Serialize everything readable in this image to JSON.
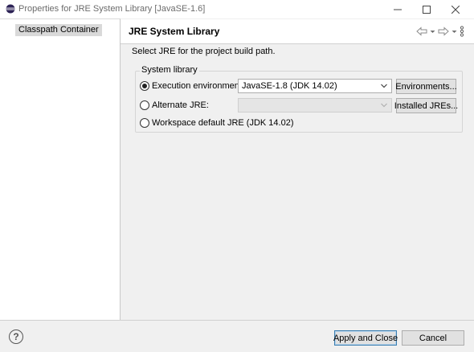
{
  "window": {
    "title": "Properties for JRE System Library [JavaSE-1.6]",
    "icon": "eclipse-icon",
    "controls": [
      "minimize-icon",
      "maximize-icon",
      "close-icon"
    ]
  },
  "sidebar": {
    "items": [
      {
        "label": "Classpath Container",
        "selected": true
      }
    ]
  },
  "page": {
    "title": "JRE System Library",
    "description": "Select JRE for the project build path."
  },
  "system_library": {
    "group_label": "System library",
    "options": [
      {
        "label": "Execution environment:",
        "checked": true,
        "combo_value": "JavaSE-1.8 (JDK 14.02)",
        "combo_enabled": true,
        "button": "Environments..."
      },
      {
        "label": "Alternate JRE:",
        "checked": false,
        "combo_value": "",
        "combo_enabled": false,
        "button": "Installed JREs..."
      },
      {
        "label": "Workspace default JRE (JDK 14.02)",
        "checked": false
      }
    ]
  },
  "footer": {
    "help_icon": "help-icon",
    "apply_close": "Apply and Close",
    "cancel": "Cancel"
  },
  "colors": {
    "dialog_background": "#f0f0f0",
    "selection": "#d9d9d9",
    "default_button_border": "#3c7fb1"
  }
}
